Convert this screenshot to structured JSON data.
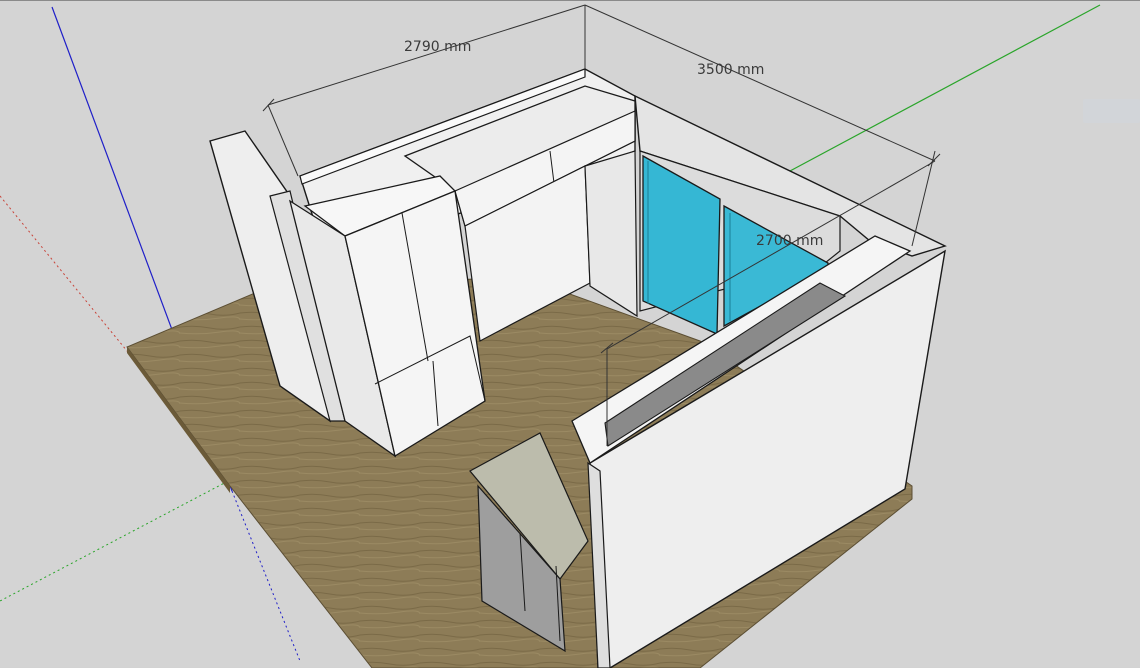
{
  "viewport": {
    "name": "3D modeling viewport",
    "background": "#d4d4d4"
  },
  "dimensions": {
    "width_label": "2790 mm",
    "depth_label": "3500 mm",
    "height_label": "2700 mm"
  },
  "axes": {
    "red": "#c8443a",
    "green": "#2aa52a",
    "blue": "#1f1fc8"
  },
  "colors": {
    "floor": "#8a7a55",
    "wall": "#ececec",
    "wall_shade": "#dcdcdc",
    "glass": "#33b8d6",
    "countertop": "#b8b8a8",
    "cabinet": "#9a9a9a",
    "edge": "#1a1a1a"
  }
}
